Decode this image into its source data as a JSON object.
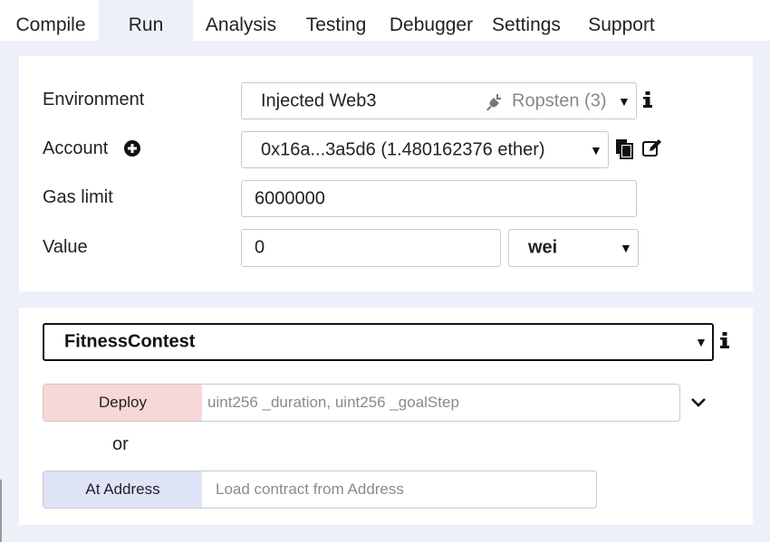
{
  "tabs": [
    {
      "label": "Compile"
    },
    {
      "label": "Run"
    },
    {
      "label": "Analysis"
    },
    {
      "label": "Testing"
    },
    {
      "label": "Debugger"
    },
    {
      "label": "Settings"
    },
    {
      "label": "Support"
    }
  ],
  "active_tab": "Run",
  "environment": {
    "label": "Environment",
    "value": "Injected Web3",
    "network": "Ropsten (3)"
  },
  "account": {
    "label": "Account",
    "value": "0x16a...3a5d6 (1.480162376 ether)"
  },
  "gas_limit": {
    "label": "Gas limit",
    "value": "6000000"
  },
  "value": {
    "label": "Value",
    "amount": "0",
    "unit": "wei"
  },
  "contract": {
    "selected": "FitnessContest"
  },
  "deploy": {
    "label": "Deploy",
    "placeholder": "uint256 _duration, uint256 _goalStep"
  },
  "or_text": "or",
  "at_address": {
    "label": "At Address",
    "placeholder": "Load contract from Address"
  },
  "colors": {
    "deploy_bg": "#f8d7d8",
    "at_address_bg": "#dfe3f8",
    "page_bg": "#eef0f9"
  }
}
